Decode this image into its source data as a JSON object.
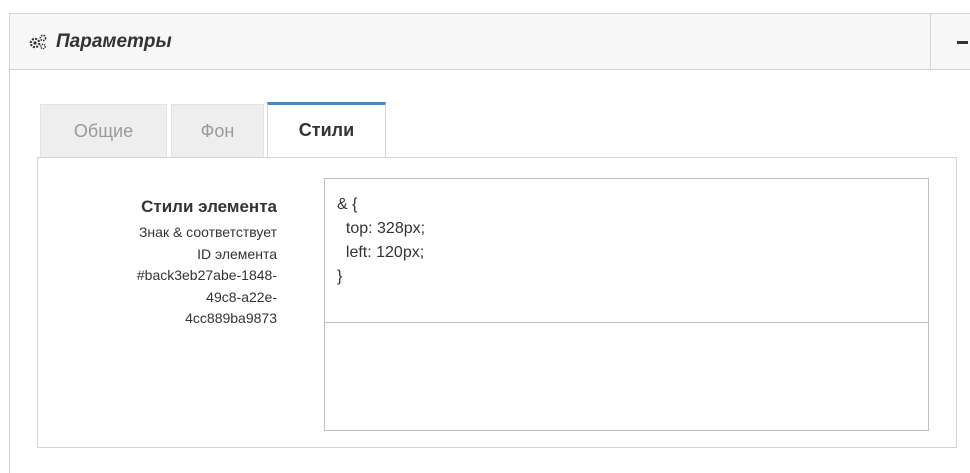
{
  "panel": {
    "title": "Параметры",
    "icon": "gears-icon",
    "collapse_icon": "minus-icon"
  },
  "tabs": [
    {
      "label": "Общие",
      "active": false
    },
    {
      "label": "Фон",
      "active": false
    },
    {
      "label": "Стили",
      "active": true
    }
  ],
  "styles_field": {
    "label": "Стили элемента",
    "hint_lines": [
      "Знак & соответствует",
      "ID элемента",
      "#back3eb27abe-1848-",
      "49c8-a22e-",
      "4cc889ba9873"
    ],
    "code_lines": [
      "& {",
      "  top: 328px;",
      "  left: 120px;",
      "}"
    ]
  },
  "colors": {
    "active_tab_accent": "#428bca",
    "header_bg": "#f7f7f7",
    "inactive_tab_bg": "#eeeeee"
  }
}
